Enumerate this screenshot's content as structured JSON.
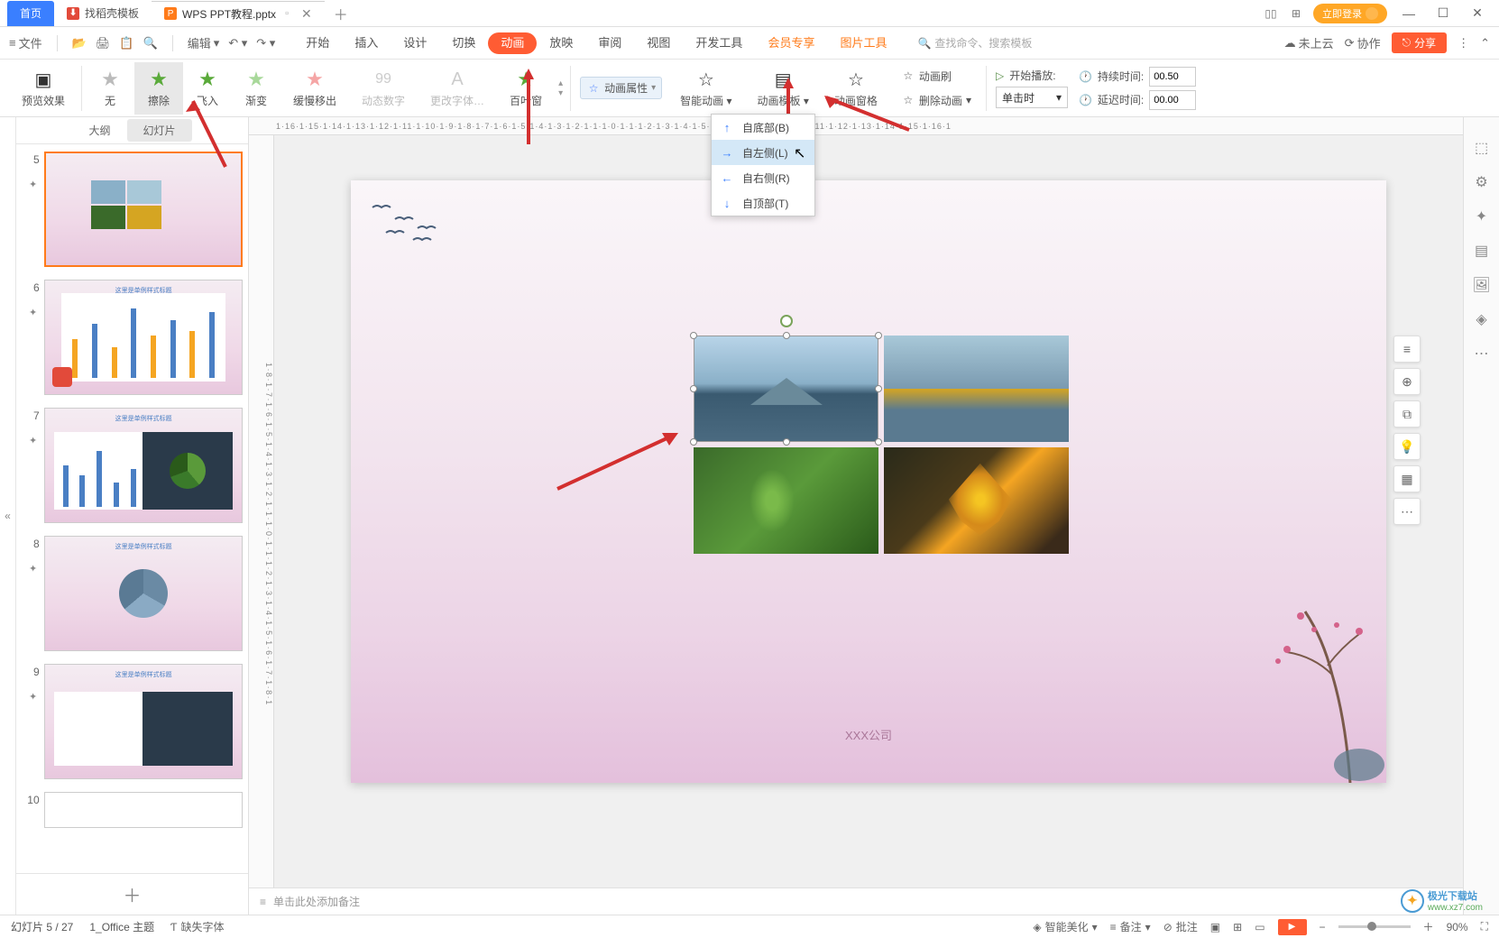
{
  "titlebar": {
    "home_tab": "首页",
    "template_tab": "找稻壳模板",
    "doc_tab": "WPS PPT教程.pptx",
    "login": "立即登录"
  },
  "menubar": {
    "file": "文件",
    "edit": "编辑",
    "tabs": {
      "start": "开始",
      "insert": "插入",
      "design": "设计",
      "transition": "切换",
      "animation": "动画",
      "slideshow": "放映",
      "review": "审阅",
      "view": "视图",
      "devtools": "开发工具",
      "member": "会员专享",
      "pictools": "图片工具"
    },
    "search_ph": "查找命令、搜索模板",
    "cloud": "未上云",
    "collab": "协作",
    "share": "分享"
  },
  "ribbon": {
    "preview": "预览效果",
    "none": "无",
    "wipe": "擦除",
    "flyin": "飞入",
    "fade": "渐变",
    "slowmove": "缓慢移出",
    "dynnum": "动态数字",
    "morefont": "更改字体…",
    "flipbook": "百叶窗",
    "animprop": "动画属性",
    "smartanim": "智能动画",
    "animtpl": "动画模板",
    "animpane": "动画窗格",
    "animbrush": "动画刷",
    "delanim": "删除动画",
    "startplay": "开始播放:",
    "duration": "持续时间:",
    "delay": "延迟时间:",
    "duration_val": "00.50",
    "delay_val": "00.00",
    "start_mode": "单击时"
  },
  "dropdown": {
    "bottom": "自底部(B)",
    "left": "自左侧(L)",
    "right": "自右侧(R)",
    "top": "自顶部(T)"
  },
  "slidepanel": {
    "outline": "大纲",
    "slides": "幻灯片",
    "thumbs": [
      {
        "num": "5",
        "selected": true
      },
      {
        "num": "6",
        "selected": false
      },
      {
        "num": "7",
        "selected": false
      },
      {
        "num": "8",
        "selected": false
      },
      {
        "num": "9",
        "selected": false
      },
      {
        "num": "10",
        "selected": false
      }
    ]
  },
  "canvas": {
    "company": "XXX公司"
  },
  "notes": {
    "placeholder": "单击此处添加备注"
  },
  "statusbar": {
    "slide_pos": "幻灯片 5 / 27",
    "theme": "1_Office 主题",
    "missing_font": "缺失字体",
    "beautify": "智能美化",
    "notes": "备注",
    "comments": "批注",
    "zoom": "90%"
  },
  "ruler": "1·16·1·15·1·14·1·13·1·12·1·11·1·10·1·9·1·8·1·7·1·6·1·5·1·4·1·3·1·2·1·1·1·0·1·1·1·2·1·3·1·4·1·5·1·6·1·7·1·8·1·9·1·10·1·11·1·12·1·13·1·14·1·15·1·16·1",
  "ruler_v": "1·8·1·7·1·6·1·5·1·4·1·3·1·2·1·1·1·0·1·1·1·2·1·3·1·4·1·5·1·6·1·7·1·8·1",
  "watermark": {
    "brand": "极光下载站",
    "url": "www.xz7.com"
  }
}
